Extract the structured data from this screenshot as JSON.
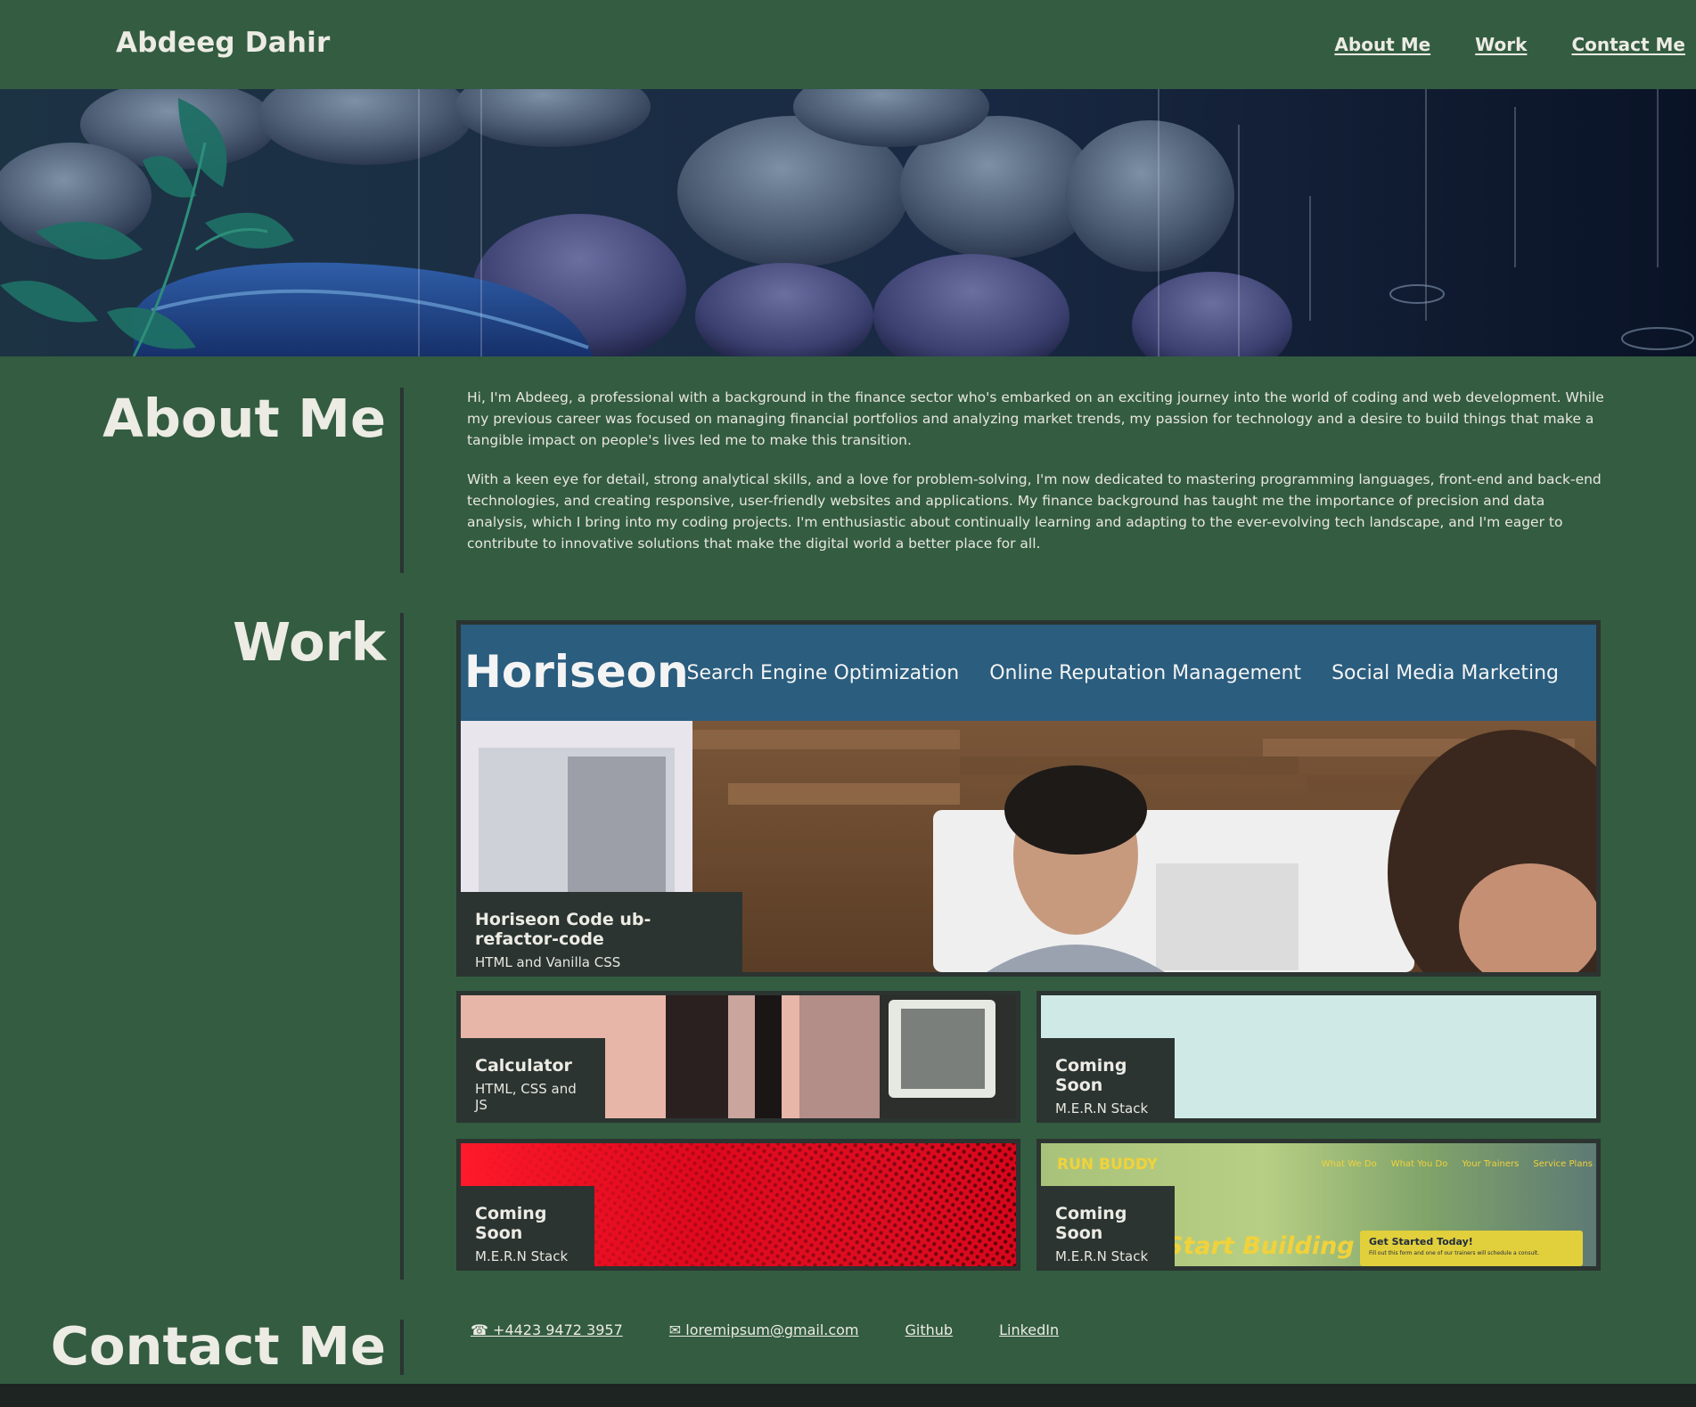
{
  "header": {
    "brand": "Abdeeg Dahir",
    "nav": [
      "About Me",
      "Work",
      "Contact Me"
    ]
  },
  "about": {
    "title": "About Me",
    "paragraphs": [
      "Hi, I'm Abdeeg, a professional with a background in the finance sector who's embarked on an exciting journey into the world of coding and web development. While my previous career was focused on managing financial portfolios and analyzing market trends, my passion for technology and a desire to build things that make a tangible impact on people's lives led me to make this transition.",
      "With a keen eye for detail, strong analytical skills, and a love for problem-solving, I'm now dedicated to mastering programming languages, front-end and back-end technologies, and creating responsive, user-friendly websites and applications. My finance background has taught me the importance of precision and data analysis, which I bring into my coding projects. I'm enthusiastic about continually learning and adapting to the ever-evolving tech landscape, and I'm eager to contribute to innovative solutions that make the digital world a better place for all."
    ]
  },
  "work": {
    "title": "Work",
    "featured": {
      "title": "Horiseon Code ub-refactor-code",
      "subtitle": "HTML and Vanilla CSS",
      "screenshot": {
        "logo": "Horiseon",
        "nav": [
          "Search Engine Optimization",
          "Online Reputation Management",
          "Social Media Marketing"
        ]
      }
    },
    "projects": [
      {
        "title": "Calculator",
        "subtitle": "HTML, CSS and JS"
      },
      {
        "title": "Coming Soon",
        "subtitle": "M.E.R.N Stack"
      },
      {
        "title": "Coming Soon",
        "subtitle": "M.E.R.N Stack"
      },
      {
        "title": "Coming Soon",
        "subtitle": "M.E.R.N Stack"
      }
    ],
    "runbuddy": {
      "logo": "RUN BUDDY",
      "nav": [
        "What We Do",
        "What You Do",
        "Your Trainers",
        "Service Plans"
      ],
      "headline": "Start Building",
      "cta": "Get Started Today!",
      "cta_sub": "Fill out this form and one of our trainers will schedule a consult."
    }
  },
  "contact": {
    "title": "Contact Me",
    "phone_icon": "phone-icon",
    "phone": "+4423 9472 3957",
    "mail_icon": "mail-icon",
    "email": "loremipsum@gmail.com",
    "github": "Github",
    "linkedin": "LinkedIn"
  },
  "colors": {
    "background": "#335c41",
    "card": "#2b3431",
    "text": "#ecebe4",
    "horiseon_blue": "#2a5d7e"
  }
}
